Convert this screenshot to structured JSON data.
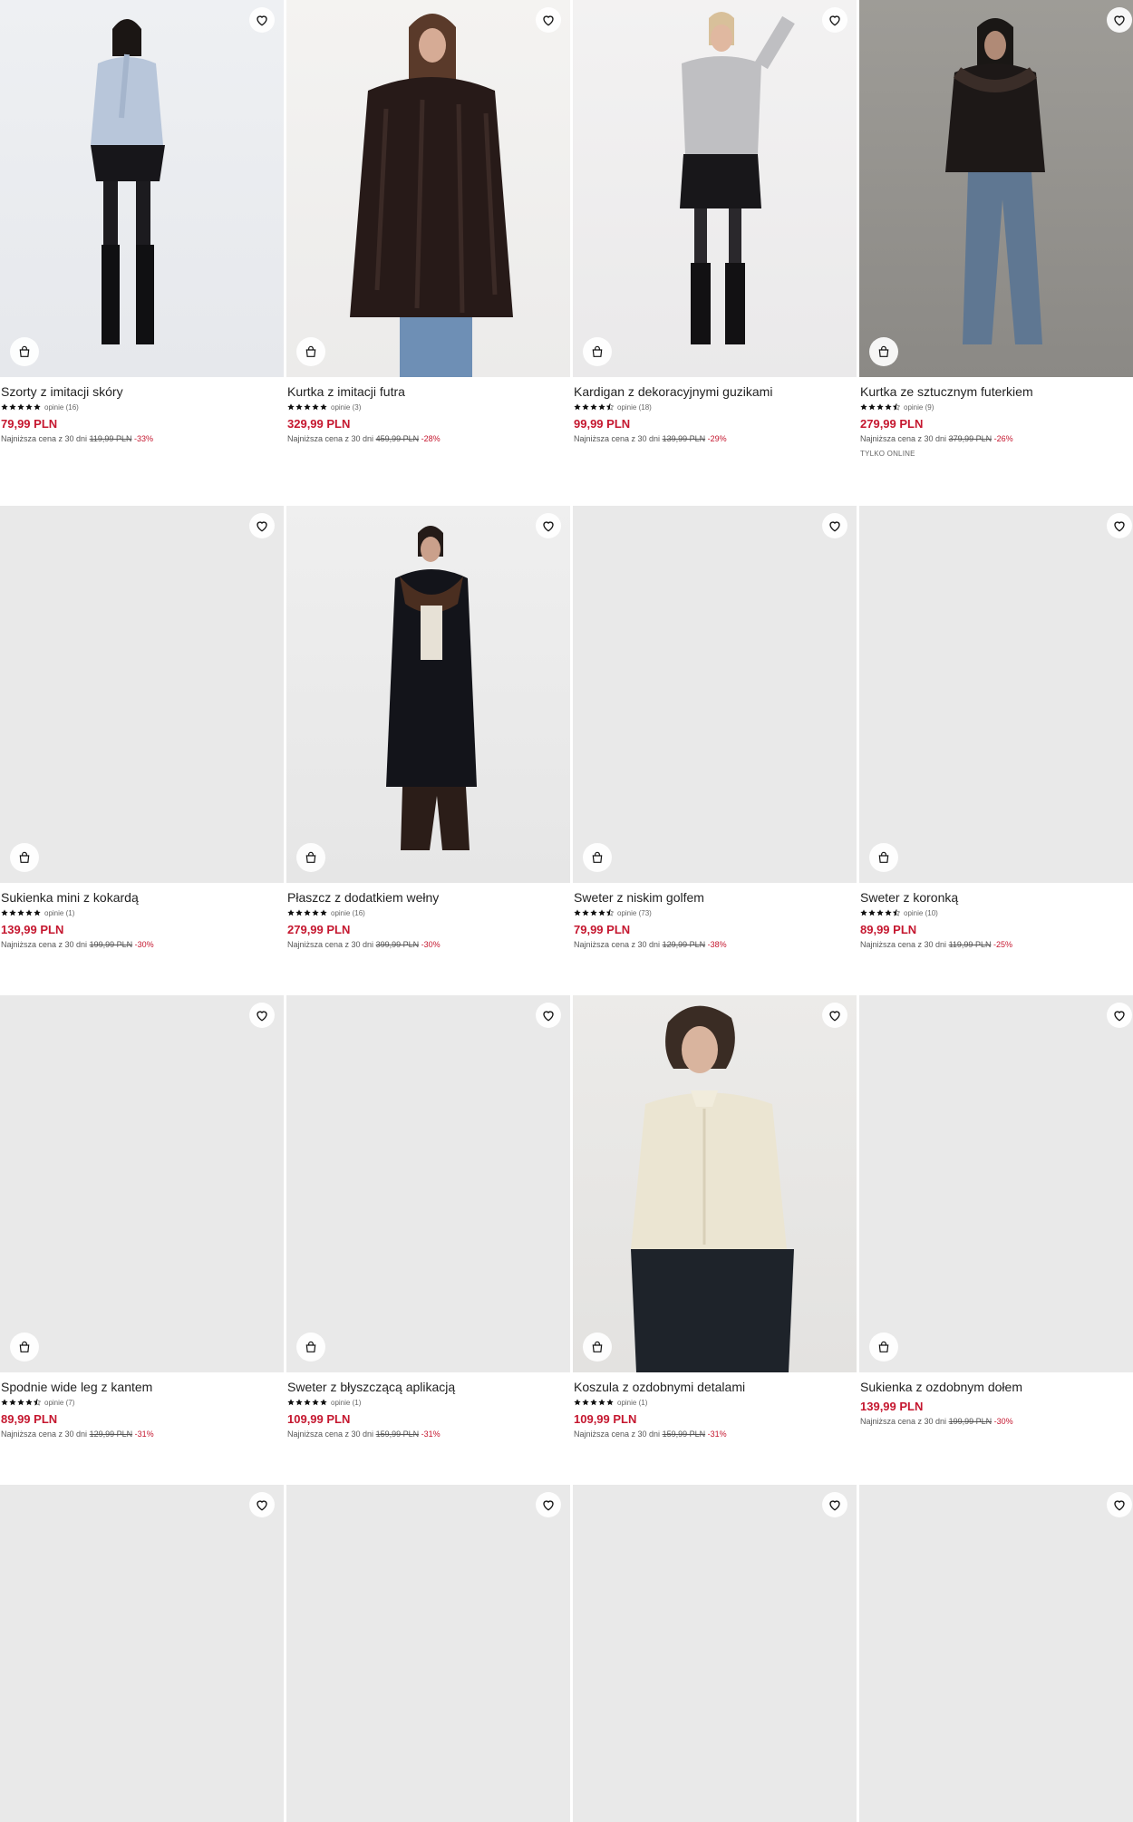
{
  "colors": {
    "sale_price": "#c5172f",
    "placeholder_bg": "#e9e9e9"
  },
  "products": [
    {
      "name": "Szorty z imitacji skóry",
      "stars": 5,
      "reviews": "opinie (16)",
      "price": "79,99 PLN",
      "lowest_label": "Najniższa cena z 30 dni",
      "old_price": "119,99 PLN",
      "discount": "-33%",
      "badge": "",
      "image": "model-blue-blouse-shorts"
    },
    {
      "name": "Kurtka z imitacji futra",
      "stars": 5,
      "reviews": "opinie (3)",
      "price": "329,99 PLN",
      "lowest_label": "Najniższa cena z 30 dni",
      "old_price": "459,99 PLN",
      "discount": "-28%",
      "badge": "",
      "image": "model-faux-fur-coat"
    },
    {
      "name": "Kardigan z dekoracyjnymi guzikami",
      "stars": 4.5,
      "reviews": "opinie (18)",
      "price": "99,99 PLN",
      "lowest_label": "Najniższa cena z 30 dni",
      "old_price": "139,99 PLN",
      "discount": "-29%",
      "badge": "",
      "image": "model-grey-cardigan"
    },
    {
      "name": "Kurtka ze sztucznym futerkiem",
      "stars": 4.5,
      "reviews": "opinie (9)",
      "price": "279,99 PLN",
      "lowest_label": "Najniższa cena z 30 dni",
      "old_price": "379,99 PLN",
      "discount": "-26%",
      "badge": "TYLKO ONLINE",
      "image": "model-black-jacket-jeans"
    },
    {
      "name": "Sukienka mini z kokardą",
      "stars": 5,
      "reviews": "opinie (1)",
      "price": "139,99 PLN",
      "lowest_label": "Najniższa cena z 30 dni",
      "old_price": "199,99 PLN",
      "discount": "-30%",
      "badge": "",
      "image": ""
    },
    {
      "name": "Płaszcz z dodatkiem wełny",
      "stars": 5,
      "reviews": "opinie (16)",
      "price": "279,99 PLN",
      "lowest_label": "Najniższa cena z 30 dni",
      "old_price": "399,99 PLN",
      "discount": "-30%",
      "badge": "",
      "image": "model-black-coat-fur-collar"
    },
    {
      "name": "Sweter z niskim golfem",
      "stars": 4.5,
      "reviews": "opinie (73)",
      "price": "79,99 PLN",
      "lowest_label": "Najniższa cena z 30 dni",
      "old_price": "129,99 PLN",
      "discount": "-38%",
      "badge": "",
      "image": ""
    },
    {
      "name": "Sweter z koronką",
      "stars": 4.5,
      "reviews": "opinie (10)",
      "price": "89,99 PLN",
      "lowest_label": "Najniższa cena z 30 dni",
      "old_price": "119,99 PLN",
      "discount": "-25%",
      "badge": "",
      "image": ""
    },
    {
      "name": "Spodnie wide leg z kantem",
      "stars": 4.5,
      "reviews": "opinie (7)",
      "price": "89,99 PLN",
      "lowest_label": "Najniższa cena z 30 dni",
      "old_price": "129,99 PLN",
      "discount": "-31%",
      "badge": "",
      "image": ""
    },
    {
      "name": "Sweter z błyszczącą aplikacją",
      "stars": 5,
      "reviews": "opinie (1)",
      "price": "109,99 PLN",
      "lowest_label": "Najniższa cena z 30 dni",
      "old_price": "159,99 PLN",
      "discount": "-31%",
      "badge": "",
      "image": ""
    },
    {
      "name": "Koszula z ozdobnymi detalami",
      "stars": 5,
      "reviews": "opinie (1)",
      "price": "109,99 PLN",
      "lowest_label": "Najniższa cena z 30 dni",
      "old_price": "159,99 PLN",
      "discount": "-31%",
      "badge": "",
      "image": "model-cream-blouse"
    },
    {
      "name": "Sukienka z ozdobnym dołem",
      "stars": 0,
      "reviews": "",
      "price": "139,99 PLN",
      "lowest_label": "Najniższa cena z 30 dni",
      "old_price": "199,99 PLN",
      "discount": "-30%",
      "badge": "",
      "image": ""
    },
    {
      "name": "",
      "stars": 0,
      "reviews": "",
      "price": "",
      "lowest_label": "",
      "old_price": "",
      "discount": "",
      "badge": "",
      "image": ""
    },
    {
      "name": "",
      "stars": 0,
      "reviews": "",
      "price": "",
      "lowest_label": "",
      "old_price": "",
      "discount": "",
      "badge": "",
      "image": ""
    },
    {
      "name": "",
      "stars": 0,
      "reviews": "",
      "price": "",
      "lowest_label": "",
      "old_price": "",
      "discount": "",
      "badge": "",
      "image": ""
    },
    {
      "name": "",
      "stars": 0,
      "reviews": "",
      "price": "",
      "lowest_label": "",
      "old_price": "",
      "discount": "",
      "badge": "",
      "image": ""
    }
  ]
}
